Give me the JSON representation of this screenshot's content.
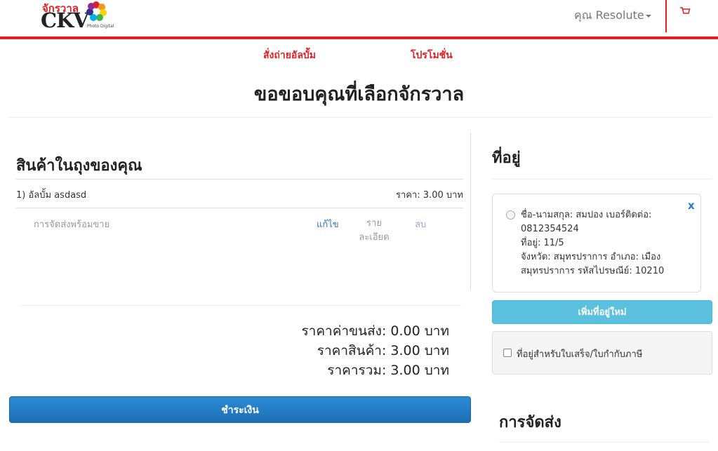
{
  "header": {
    "logo_thai": "จักรวาล",
    "logo_main": "CKV",
    "logo_sub": "Photo Digital",
    "user_label": "คุณ Resolute",
    "cart_icon": "cart-icon",
    "brand_color": "#e31e24"
  },
  "nav": {
    "items": [
      {
        "label": "สั่งถ่ายอัลบั้ม"
      },
      {
        "label": "โปรโมชั่น"
      }
    ]
  },
  "page": {
    "title": "ขอขอบคุณที่เลือกจักรวาล"
  },
  "cart": {
    "heading": "สินค้าในถุงของคุณ",
    "items": [
      {
        "name": "1) อัลบั้ม asdasd",
        "price": "ราคา: 3.00 บาท",
        "status": "การจัดส่งพร้อมขาย",
        "edit": "แก้ไข",
        "detail": "ราย ละเอียด",
        "delete": "ลบ"
      }
    ],
    "shipping_total": "ราคาค่าขนส่ง: 0.00 บาท",
    "product_total": "ราคาสินค้า: 3.00 บาท",
    "grand_total": "ราคารวม: 3.00 บาท",
    "pay_button": "ชำระเงิน",
    "pay_color": "#1d6eb4"
  },
  "address": {
    "heading": "ที่อยู่",
    "close_label": "x",
    "lines": [
      "ชื่อ-นามสกุล: สมปอง เบอร์ติดต่อ: 0812354524",
      "ที่อยู่: 11/5",
      "จังหวัด: สมุทรปราการ อำเภอ: เมืองสมุทรปราการ รหัสไปรษณีย์: 10210"
    ],
    "add_button": "เพิ่มที่อยู่ใหม่",
    "add_color": "#5bc0de",
    "tax_label": "ที่อยู่สำหรับใบเสร็จ/ใบกำกับภาษี"
  },
  "shipping": {
    "heading": "การจัดส่ง"
  }
}
